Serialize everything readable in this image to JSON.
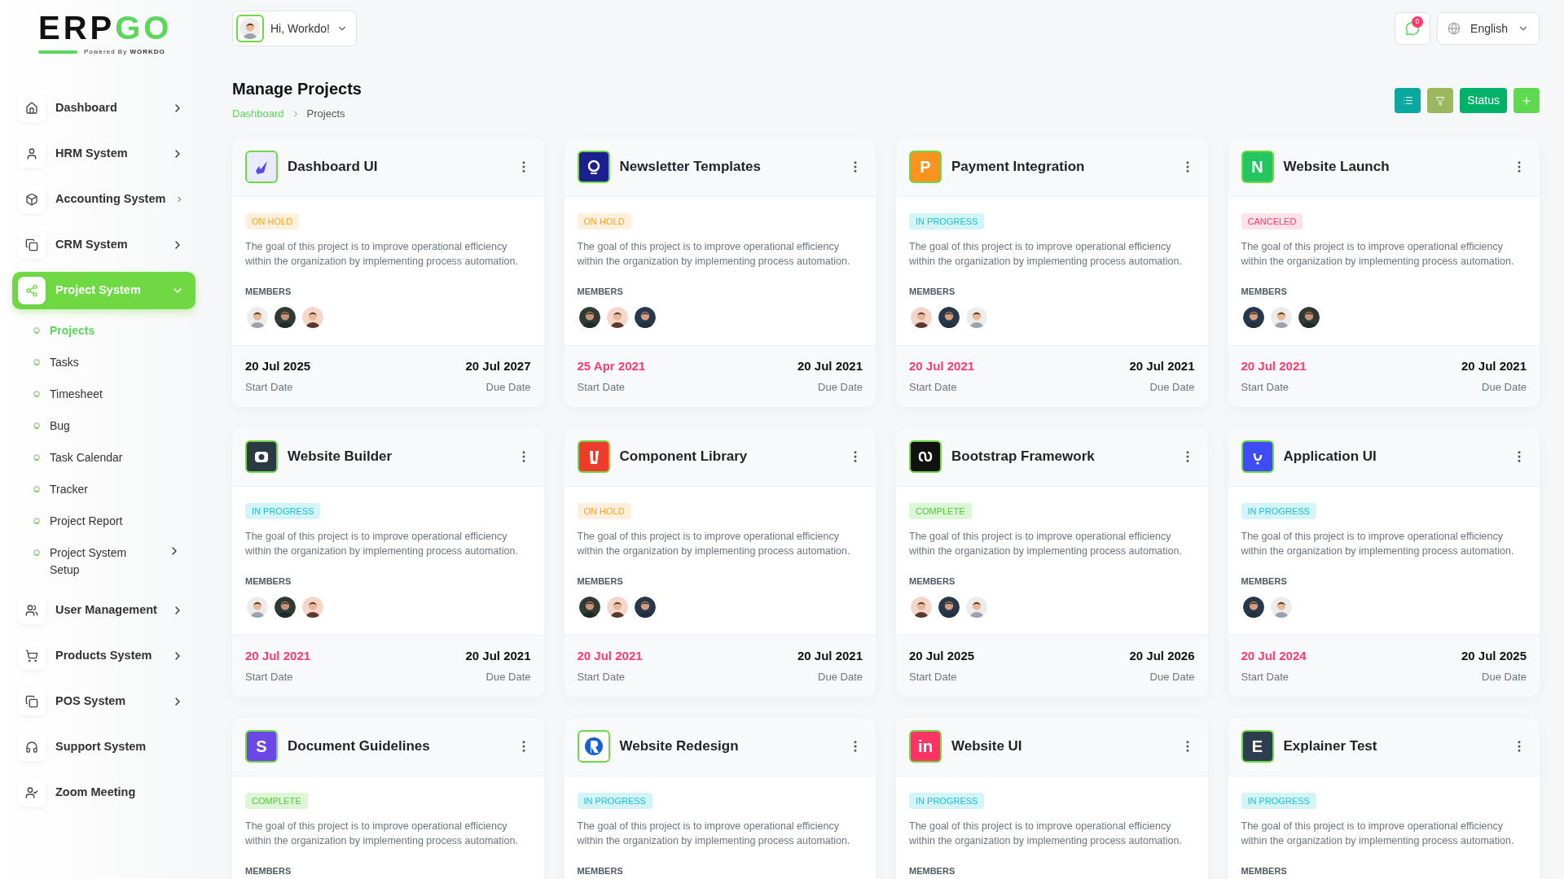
{
  "logo": {
    "dark": "ERP",
    "green": "GO",
    "tagline": "Powered By",
    "brand": "WORKDO"
  },
  "user_menu": {
    "greeting": "Hi, Workdo!"
  },
  "notifications": {
    "count": "0"
  },
  "language": {
    "label": "English"
  },
  "sidebar": {
    "items": [
      {
        "label": "Dashboard",
        "selected": false,
        "expanded": false
      },
      {
        "label": "HRM System",
        "selected": false,
        "expanded": false
      },
      {
        "label": "Accounting System",
        "selected": false,
        "expanded": false
      },
      {
        "label": "CRM System",
        "selected": false,
        "expanded": false
      },
      {
        "label": "Project System",
        "selected": true,
        "expanded": true,
        "children": [
          {
            "label": "Projects",
            "selected": true
          },
          {
            "label": "Tasks",
            "selected": false
          },
          {
            "label": "Timesheet",
            "selected": false
          },
          {
            "label": "Bug",
            "selected": false
          },
          {
            "label": "Task Calendar",
            "selected": false
          },
          {
            "label": "Tracker",
            "selected": false
          },
          {
            "label": "Project Report",
            "selected": false
          },
          {
            "label": "Project System Setup",
            "selected": false,
            "expanded": false
          }
        ]
      },
      {
        "label": "User Management",
        "selected": false,
        "expanded": false
      },
      {
        "label": "Products System",
        "selected": false,
        "expanded": false
      },
      {
        "label": "POS System",
        "selected": false,
        "expanded": false
      },
      {
        "label": "Support System",
        "selected": false
      },
      {
        "label": "Zoom Meeting",
        "selected": false
      }
    ]
  },
  "page": {
    "title": "Manage Projects",
    "breadcrumb": [
      "Dashboard",
      "Projects"
    ],
    "toolbar": {
      "status_button": "Status"
    }
  },
  "projects": [
    {
      "name": "Dashboard UI",
      "logo": {
        "kind": "check",
        "color": "#ebeafd"
      },
      "status": {
        "label": "ON HOLD",
        "kind": "on_hold"
      },
      "description": "The goal of this project is to improve operational efficiency within the organization by implementing process automation.",
      "members_label": "MEMBERS",
      "start": {
        "date": "20 Jul 2025",
        "label": "Start Date",
        "overdue": false
      },
      "due": {
        "date": "20 Jul 2027",
        "label": "Due Date"
      }
    },
    {
      "name": "Newsletter Templates",
      "logo": {
        "kind": "ring",
        "color": "#1b1f8f"
      },
      "status": {
        "label": "ON HOLD",
        "kind": "on_hold"
      },
      "description": "The goal of this project is to improve operational efficiency within the organization by implementing process automation.",
      "members_label": "MEMBERS",
      "start": {
        "date": "25 Apr 2021",
        "label": "Start Date",
        "overdue": true
      },
      "due": {
        "date": "20 Jul 2021",
        "label": "Due Date"
      }
    },
    {
      "name": "Payment Integration",
      "logo": {
        "kind": "letter",
        "letter": "P",
        "color": "#f7931e"
      },
      "status": {
        "label": "IN PROGRESS",
        "kind": "in_progress"
      },
      "description": "The goal of this project is to improve operational efficiency within the organization by implementing process automation.",
      "members_label": "MEMBERS",
      "start": {
        "date": "20 Jul 2021",
        "label": "Start Date",
        "overdue": true
      },
      "due": {
        "date": "20 Jul 2021",
        "label": "Due Date"
      }
    },
    {
      "name": "Website Launch",
      "logo": {
        "kind": "letter",
        "letter": "N",
        "color": "#22c55e"
      },
      "status": {
        "label": "CANCELED",
        "kind": "canceled"
      },
      "description": "The goal of this project is to improve operational efficiency within the organization by implementing process automation.",
      "members_label": "MEMBERS",
      "start": {
        "date": "20 Jul 2021",
        "label": "Start Date",
        "overdue": true
      },
      "due": {
        "date": "20 Jul 2021",
        "label": "Due Date"
      }
    },
    {
      "name": "Website Builder",
      "logo": {
        "kind": "camera",
        "color": "#2b3a42"
      },
      "status": {
        "label": "IN PROGRESS",
        "kind": "in_progress"
      },
      "description": "The goal of this project is to improve operational efficiency within the organization by implementing process automation.",
      "members_label": "MEMBERS",
      "start": {
        "date": "20 Jul 2021",
        "label": "Start Date",
        "overdue": true
      },
      "due": {
        "date": "20 Jul 2021",
        "label": "Due Date"
      }
    },
    {
      "name": "Component Library",
      "logo": {
        "kind": "shape",
        "color": "#ef3b2c"
      },
      "status": {
        "label": "ON HOLD",
        "kind": "on_hold"
      },
      "description": "The goal of this project is to improve operational efficiency within the organization by implementing process automation.",
      "members_label": "MEMBERS",
      "start": {
        "date": "20 Jul 2021",
        "label": "Start Date",
        "overdue": true
      },
      "due": {
        "date": "20 Jul 2021",
        "label": "Due Date"
      }
    },
    {
      "name": "Bootstrap Framework",
      "logo": {
        "kind": "loop",
        "color": "#111111"
      },
      "status": {
        "label": "COMPLETE",
        "kind": "complete"
      },
      "description": "The goal of this project is to improve operational efficiency within the organization by implementing process automation.",
      "members_label": "MEMBERS",
      "start": {
        "date": "20 Jul 2025",
        "label": "Start Date",
        "overdue": false
      },
      "due": {
        "date": "20 Jul 2026",
        "label": "Due Date"
      }
    },
    {
      "name": "Application UI",
      "logo": {
        "kind": "hook",
        "color": "#3d4cf5"
      },
      "status": {
        "label": "IN PROGRESS",
        "kind": "in_progress"
      },
      "description": "The goal of this project is to improve operational efficiency within the organization by implementing process automation.",
      "members_label": "MEMBERS",
      "start": {
        "date": "20 Jul 2024",
        "label": "Start Date",
        "overdue": true
      },
      "due": {
        "date": "20 Jul 2025",
        "label": "Due Date"
      }
    },
    {
      "name": "Document Guidelines",
      "logo": {
        "kind": "letter",
        "letter": "S",
        "color": "#6c47e8"
      },
      "status": {
        "label": "COMPLETE",
        "kind": "complete"
      },
      "description": "The goal of this project is to improve operational efficiency within the organization by implementing process automation.",
      "members_label": "MEMBERS"
    },
    {
      "name": "Website Redesign",
      "logo": {
        "kind": "badge_r",
        "color": "#1a5fd6"
      },
      "status": {
        "label": "IN PROGRESS",
        "kind": "in_progress"
      },
      "description": "The goal of this project is to improve operational efficiency within the organization by implementing process automation.",
      "members_label": "MEMBERS"
    },
    {
      "name": "Website UI",
      "logo": {
        "kind": "letter",
        "letter": "in",
        "color": "#ff3366"
      },
      "status": {
        "label": "IN PROGRESS",
        "kind": "in_progress"
      },
      "description": "The goal of this project is to improve operational efficiency within the organization by implementing process automation.",
      "members_label": "MEMBERS"
    },
    {
      "name": "Explainer Test",
      "logo": {
        "kind": "letter",
        "letter": "E",
        "color": "#2c3e50"
      },
      "status": {
        "label": "IN PROGRESS",
        "kind": "in_progress"
      },
      "description": "The goal of this project is to improve operational efficiency within the organization by implementing process automation.",
      "members_label": "MEMBERS"
    }
  ]
}
